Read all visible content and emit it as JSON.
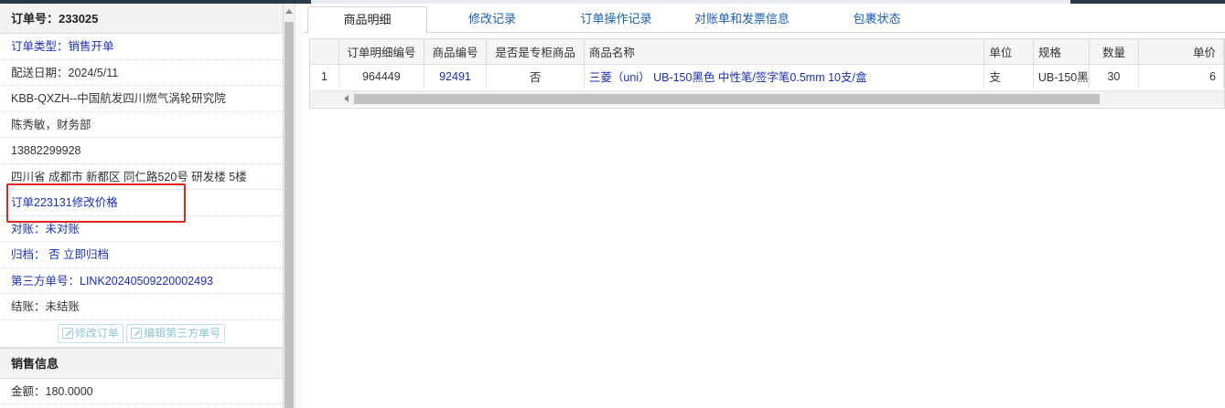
{
  "order": {
    "title": "订单号：233025",
    "rows": [
      {
        "text": "订单类型：销售开单",
        "style": "blue"
      },
      {
        "text": "配送日期：2024/5/11",
        "style": "plain"
      },
      {
        "text": "KBB-QXZH--中国航发四川燃气涡轮研究院",
        "style": "plain"
      },
      {
        "text": "陈秀敏，财务部",
        "style": "plain"
      },
      {
        "text": "13882299928",
        "style": "plain"
      },
      {
        "text": "四川省 成都市 新都区 同仁路520号 研发楼 5楼",
        "style": "plain"
      },
      {
        "text": "订单223131修改价格",
        "style": "blue"
      },
      {
        "text": "对账：未对账",
        "style": "blue"
      },
      {
        "text": "归档：  否 立即归档",
        "style": "blue"
      },
      {
        "text": "第三方单号：LINK20240509220002493",
        "style": "blue"
      },
      {
        "text": "结账：未结账",
        "style": "plain"
      }
    ],
    "buttons": {
      "edit_order": "修改订单",
      "edit_third_party": "编辑第三方单号"
    },
    "sales_header": "销售信息",
    "amount": "金额：180.0000"
  },
  "tabs": [
    {
      "label": "商品明细",
      "active": true
    },
    {
      "label": "修改记录",
      "active": false
    },
    {
      "label": "订单操作记录",
      "active": false
    },
    {
      "label": "对账单和发票信息",
      "active": false
    },
    {
      "label": "包裹状态",
      "active": false
    }
  ],
  "grid": {
    "columns": [
      "",
      "订单明细编号",
      "商品编号",
      "是否是专柜商品",
      "商品名称",
      "单位",
      "规格",
      "数量",
      "单价"
    ],
    "rows": [
      [
        "1",
        "964449",
        "92491",
        "否",
        "三菱（uni） UB-150黑色 中性笔/签字笔0.5mm 10支/盒",
        "支",
        "UB-150黑",
        "30",
        "6"
      ]
    ]
  }
}
